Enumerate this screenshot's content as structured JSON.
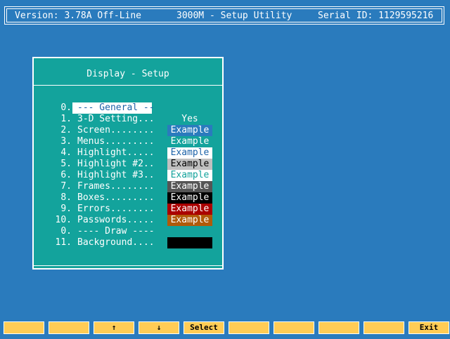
{
  "status_bar": {
    "version": "Version: 3.78A Off-Line",
    "title": "3000M - Setup Utility",
    "serial": "Serial ID: 1129595216"
  },
  "panel": {
    "title": "Display - Setup",
    "rows": [
      {
        "num": "0.",
        "label": "--- General --",
        "kind": "section-selected"
      },
      {
        "num": "1.",
        "label": "3-D Setting...",
        "value": "Yes"
      },
      {
        "num": "2.",
        "label": "Screen........",
        "value": "Example",
        "bg": "#2a7bbd",
        "fg": "#ffffff"
      },
      {
        "num": "3.",
        "label": "Menus.........",
        "value": "Example",
        "bg": "#13a39c",
        "fg": "#ffffff"
      },
      {
        "num": "4.",
        "label": "Highlight.....",
        "value": "Example",
        "bg": "#ffffff",
        "fg": "#1c62a8"
      },
      {
        "num": "5.",
        "label": "Highlight #2..",
        "value": "Example",
        "bg": "#c0c0c0",
        "fg": "#000000"
      },
      {
        "num": "6.",
        "label": "Highlight #3..",
        "value": "Example",
        "bg": "#ffffff",
        "fg": "#13a39c"
      },
      {
        "num": "7.",
        "label": "Frames........",
        "value": "Example",
        "bg": "#555555",
        "fg": "#ffffff"
      },
      {
        "num": "8.",
        "label": "Boxes.........",
        "value": "Example",
        "bg": "#000000",
        "fg": "#ffffff"
      },
      {
        "num": "9.",
        "label": "Errors........",
        "value": "Example",
        "bg": "#aa0000",
        "fg": "#ffffff"
      },
      {
        "num": "10.",
        "label": "Passwords.....",
        "value": "Example",
        "bg": "#b05a0a",
        "fg": "#ffffff"
      },
      {
        "num": "0.",
        "label": "---- Draw ----",
        "kind": "section"
      },
      {
        "num": "11.",
        "label": "Background....",
        "value": "",
        "bg": "#000000",
        "fg": "#000000"
      }
    ]
  },
  "button_bar": {
    "keys": [
      "",
      "",
      "↑",
      "↓",
      "Select",
      "",
      "",
      "",
      "",
      "Exit"
    ]
  },
  "colors": {
    "background": "#2a7bbd",
    "panel": "#13a39c",
    "function_key": "#ffcc55"
  }
}
